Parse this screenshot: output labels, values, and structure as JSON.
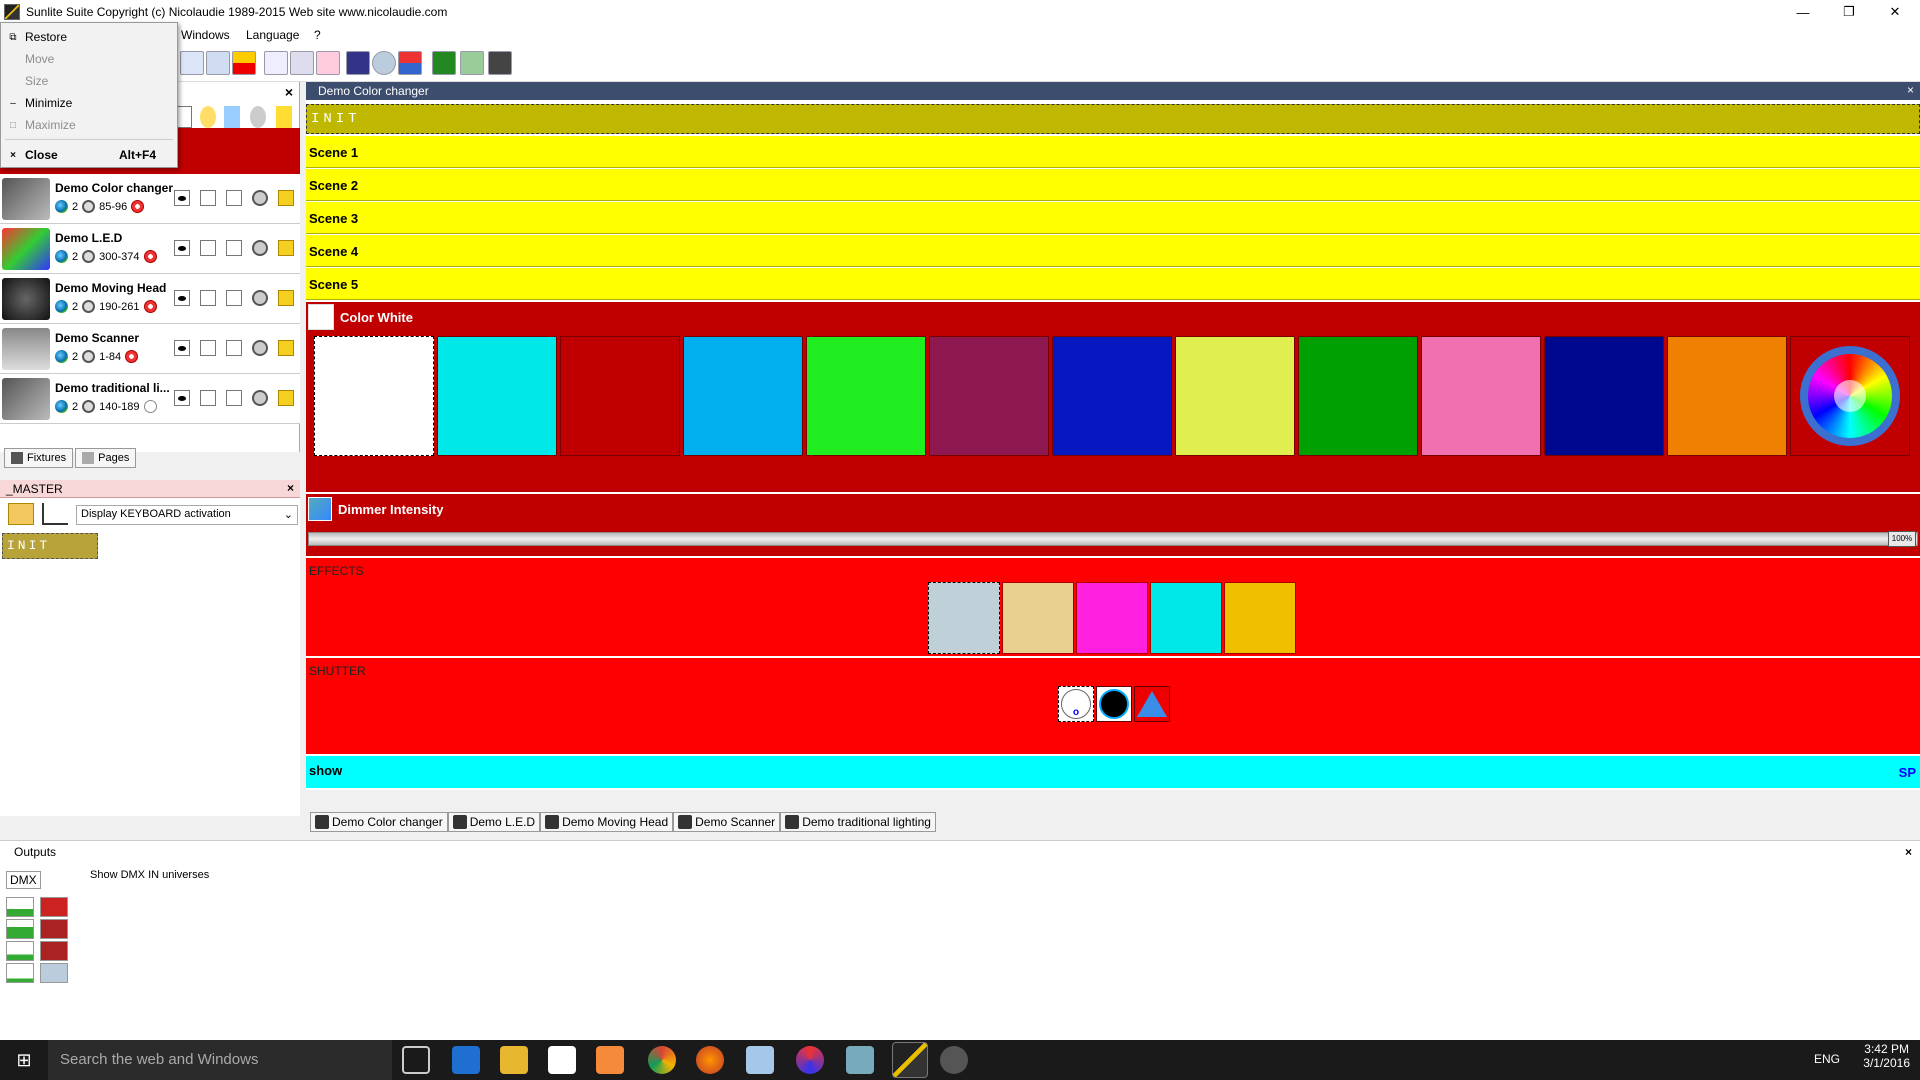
{
  "window": {
    "title": "Sunlite Suite   Copyright (c) Nicolaudie 1989-2015   Web site www.nicolaudie.com",
    "minimize": "—",
    "restore": "❐",
    "close": "✕"
  },
  "menubar": {
    "items": [
      "Windows",
      "Language",
      "?"
    ]
  },
  "system_menu": {
    "items": [
      {
        "icon": "⧉",
        "label": "Restore",
        "shortcut": "",
        "disabled": false
      },
      {
        "icon": "",
        "label": "Move",
        "shortcut": "",
        "disabled": true
      },
      {
        "icon": "",
        "label": "Size",
        "shortcut": "",
        "disabled": true
      },
      {
        "icon": "–",
        "label": "Minimize",
        "shortcut": "",
        "disabled": false
      },
      {
        "icon": "□",
        "label": "Maximize",
        "shortcut": "",
        "disabled": true
      },
      {
        "icon": "×",
        "label": "Close",
        "shortcut": "Alt+F4",
        "disabled": false
      }
    ]
  },
  "fixtures": [
    {
      "name": "Demo Color changer",
      "universe": "2",
      "channels": "85-96",
      "status": "red"
    },
    {
      "name": "Demo L.E.D",
      "universe": "2",
      "channels": "300-374",
      "status": "red"
    },
    {
      "name": "Demo Moving Head",
      "universe": "2",
      "channels": "190-261",
      "status": "red"
    },
    {
      "name": "Demo Scanner",
      "universe": "2",
      "channels": "1-84",
      "status": "red"
    },
    {
      "name": "Demo traditional li...",
      "universe": "2",
      "channels": "140-189",
      "status": "grey"
    }
  ],
  "left_tabs": [
    "Fixtures",
    "Pages"
  ],
  "master": {
    "title": "_MASTER",
    "select_value": "Display KEYBOARD activation",
    "init_label": "INIT"
  },
  "main": {
    "title": "Demo Color changer",
    "init_label": "INIT",
    "scenes": [
      "Scene 1",
      "Scene 2",
      "Scene 3",
      "Scene 4",
      "Scene 5"
    ],
    "color_section": {
      "label": "Color White",
      "colors": [
        "#ffffff",
        "#00e8e8",
        "#c00000",
        "#00b0ee",
        "#20ee20",
        "#901850",
        "#0818c0",
        "#e0ee50",
        "#00a000",
        "#f070b0",
        "#000890",
        "#f08000"
      ]
    },
    "dimmer_section": {
      "label": "Dimmer Intensity",
      "value": "100%",
      "level": 1.0
    },
    "effects_section": {
      "label": "EFFECTS",
      "colors": [
        "#c0d0d8",
        "#e8d090",
        "#ff20e0",
        "#00e8e8",
        "#f0c000"
      ]
    },
    "shutter_section": {
      "label": "SHUTTER",
      "open_label": "o"
    },
    "show_bar": {
      "label": "show",
      "right_label": "SP"
    }
  },
  "page_tabs": [
    "Demo Color changer",
    "Demo L.E.D",
    "Demo Moving Head",
    "Demo Scanner",
    "Demo traditional lighting"
  ],
  "outputs": {
    "title": "Outputs",
    "dmx_label": "DMX",
    "dmx_in_label": "Show DMX IN universes"
  },
  "taskbar": {
    "search_placeholder": "Search the web and Windows",
    "lang": "ENG",
    "time": "3:42 PM",
    "date": "3/1/2016"
  }
}
